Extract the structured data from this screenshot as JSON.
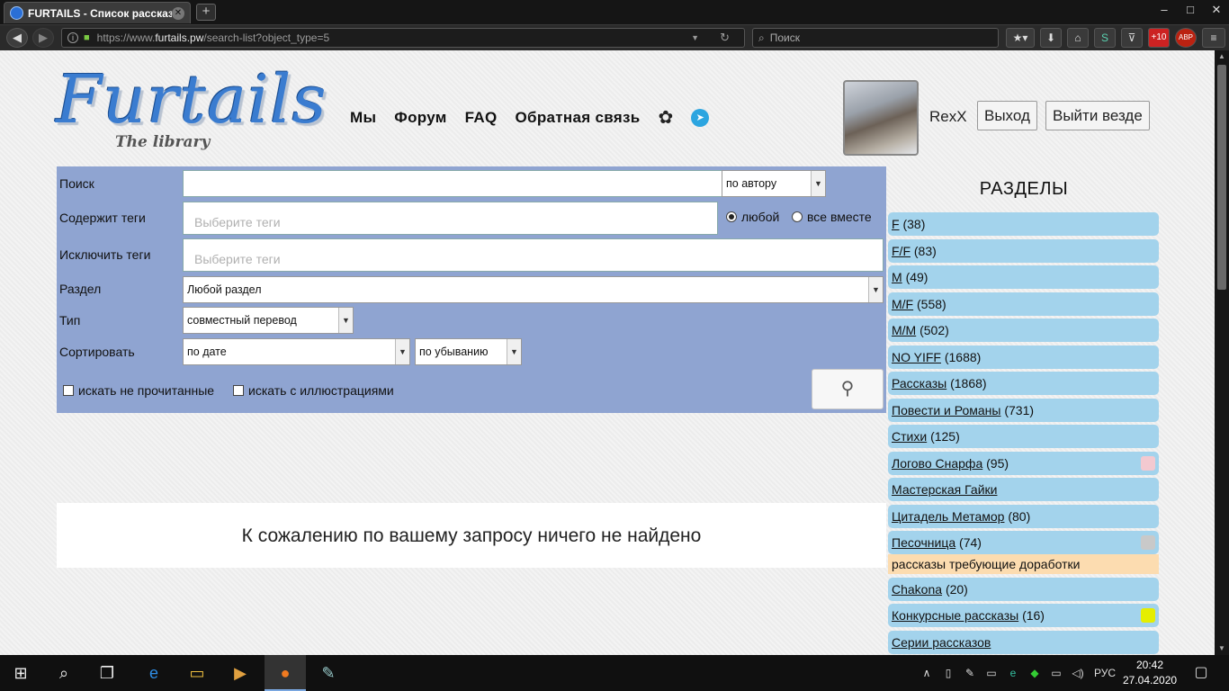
{
  "browser": {
    "tab_title": "FURTAILS - Список рассказ",
    "url_prefix": "https://www.",
    "url_host": "furtails.pw",
    "url_path": "/search-list?object_type=5",
    "search_placeholder": "Поиск",
    "badge_plus": "+10",
    "badge_abp": "ABP"
  },
  "site": {
    "logo_text": "Furtails",
    "logo_sub": "The library",
    "nav": [
      "Мы",
      "Форум",
      "FAQ",
      "Обратная связь"
    ],
    "username": "RexX",
    "logout_label": "Выход",
    "logout_all_label": "Выйти везде"
  },
  "search": {
    "label_search": "Поиск",
    "search_value": "",
    "search_by": "по автору",
    "label_tags": "Содержит теги",
    "tags_placeholder": "Выберите теги",
    "radio_any": "любой",
    "radio_all": "все вместе",
    "label_exclude": "Исключить теги",
    "exclude_placeholder": "Выберите теги",
    "label_section": "Раздел",
    "section_value": "Любой раздел",
    "label_type": "Тип",
    "type_value": "совместный перевод",
    "label_sort": "Сортировать",
    "sort_value": "по дате",
    "order_value": "по убыванию",
    "chk_unread": "искать не прочитанные",
    "chk_illustrated": "искать с иллюстрациями"
  },
  "results": {
    "empty_message": "К сожалению по вашему запросу ничего не найдено"
  },
  "sidebar": {
    "title": "РАЗДЕЛЫ",
    "items": [
      {
        "name": "F",
        "count": "(38)"
      },
      {
        "name": "F/F",
        "count": "(83)"
      },
      {
        "name": "M",
        "count": "(49)"
      },
      {
        "name": "M/F",
        "count": "(558)"
      },
      {
        "name": "M/M",
        "count": "(502)"
      },
      {
        "name": "NO YIFF",
        "count": "(1688)"
      },
      {
        "name": "Рассказы",
        "count": "(1868)"
      },
      {
        "name": "Повести и Романы",
        "count": "(731)"
      },
      {
        "name": "Стихи",
        "count": "(125)"
      },
      {
        "name": "Логово Снарфа",
        "count": "(95)",
        "color": "#f3c9d0"
      },
      {
        "name": "Мастерская Гайки",
        "count": ""
      },
      {
        "name": "Цитадель Метамор",
        "count": "(80)"
      },
      {
        "name": "Песочница",
        "count": "(74)",
        "color": "#c9c9c9"
      },
      {
        "name": "Chakona",
        "count": "(20)"
      },
      {
        "name": "Конкурсные рассказы",
        "count": "(16)",
        "color": "#e5ee00"
      },
      {
        "name": "Серии рассказов",
        "count": ""
      }
    ],
    "sandbox_note": "рассказы требующие доработки"
  },
  "taskbar": {
    "lang": "РУС",
    "time": "20:42",
    "date": "27.04.2020"
  }
}
